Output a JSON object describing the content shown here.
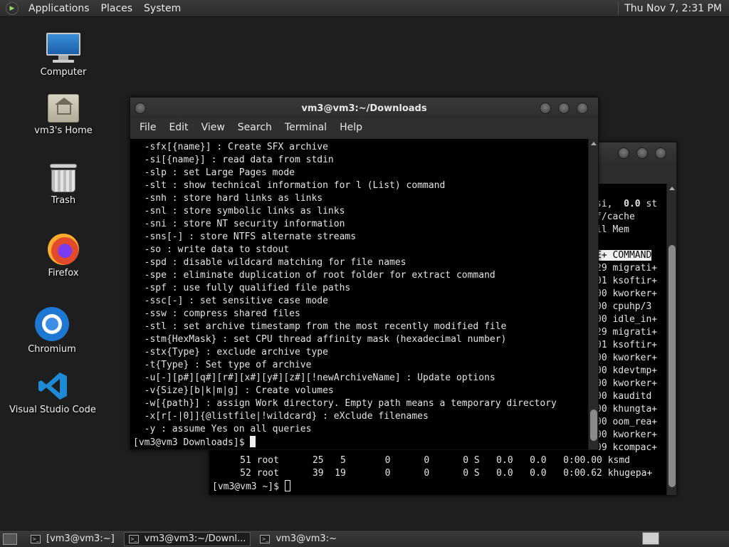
{
  "top_panel": {
    "menus": [
      "Applications",
      "Places",
      "System"
    ],
    "clock": "Thu Nov 7,  2:31 PM"
  },
  "desktop_icons": [
    {
      "label": "Computer",
      "icon": "computer-icon"
    },
    {
      "label": "vm3's Home",
      "icon": "home-folder-icon"
    },
    {
      "label": "Trash",
      "icon": "trash-icon"
    },
    {
      "label": "Firefox",
      "icon": "firefox-icon"
    },
    {
      "label": "Chromium",
      "icon": "chromium-icon"
    },
    {
      "label": "Visual Studio Code",
      "icon": "vscode-icon"
    }
  ],
  "front_terminal": {
    "title": "vm3@vm3:~/Downloads",
    "menus": [
      "File",
      "Edit",
      "View",
      "Search",
      "Terminal",
      "Help"
    ],
    "lines": [
      "  -sfx[{name}] : Create SFX archive",
      "  -si[{name}] : read data from stdin",
      "  -slp : set Large Pages mode",
      "  -slt : show technical information for l (List) command",
      "  -snh : store hard links as links",
      "  -snl : store symbolic links as links",
      "  -sni : store NT security information",
      "  -sns[-] : store NTFS alternate streams",
      "  -so : write data to stdout",
      "  -spd : disable wildcard matching for file names",
      "  -spe : eliminate duplication of root folder for extract command",
      "  -spf : use fully qualified file paths",
      "  -ssc[-] : set sensitive case mode",
      "  -ssw : compress shared files",
      "  -stl : set archive timestamp from the most recently modified file",
      "  -stm{HexMask} : set CPU thread affinity mask (hexadecimal number)",
      "  -stx{Type} : exclude archive type",
      "  -t{Type} : Set type of archive",
      "  -u[-][p#][q#][r#][x#][y#][z#][!newArchiveName] : Update options",
      "  -v{Size}[b|k|m|g] : Create volumes",
      "  -w[{path}] : assign Work directory. Empty path means a temporary directory",
      "  -x[r[-|0]]{@listfile|!wildcard} : eXclude filenames",
      "  -y : assume Yes on all queries"
    ],
    "prompt": "[vm3@vm3 Downloads]$ "
  },
  "back_terminal": {
    "right_lines": [
      {
        "text": "si,  ",
        "bold": "0.0",
        "rest": " st"
      },
      {
        "text": "f/cache"
      },
      {
        "text": "il Mem"
      },
      {
        "text": ""
      },
      {
        "text": "E+ COMMAND",
        "header": true
      },
      {
        "text": "29 migrati+"
      },
      {
        "text": "01 ksoftir+"
      },
      {
        "text": "00 kworker+"
      },
      {
        "text": "00 cpuhp/3"
      },
      {
        "text": "00 idle_in+"
      },
      {
        "text": "29 migrati+"
      },
      {
        "text": "01 ksoftir+"
      },
      {
        "text": "00 kworker+"
      },
      {
        "text": "00 kdevtmp+"
      },
      {
        "text": "00 kworker+"
      },
      {
        "text": "00 kauditd"
      },
      {
        "text": "00 khungta+"
      },
      {
        "text": "00 oom_rea+"
      },
      {
        "text": "00 kworker+"
      },
      {
        "text": "09 kcompac+"
      }
    ],
    "bottom_lines": [
      "     51 root      25   5       0      0      0 S   0.0   0.0   0:00.00 ksmd",
      "     52 root      39  19       0      0      0 S   0.0   0.0   0:00.62 khugepa+"
    ],
    "prompt": "[vm3@vm3 ~]$ "
  },
  "taskbar": {
    "items": [
      {
        "label": "[vm3@vm3:~]",
        "active": false
      },
      {
        "label": "vm3@vm3:~/Downl...",
        "active": true
      },
      {
        "label": "vm3@vm3:~",
        "active": false
      }
    ]
  }
}
